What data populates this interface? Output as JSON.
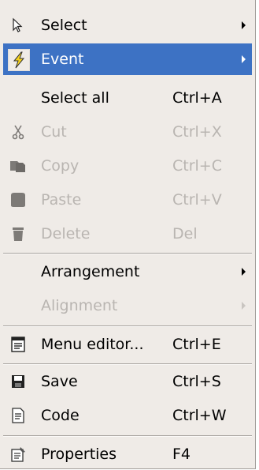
{
  "menu": {
    "items": {
      "select": {
        "label": "Select",
        "icon": "pointer-icon"
      },
      "event": {
        "label": "Event",
        "icon": "lightning-icon"
      },
      "select_all": {
        "label": "Select all",
        "shortcut": "Ctrl+A"
      },
      "cut": {
        "label": "Cut",
        "shortcut": "Ctrl+X",
        "icon": "scissors-icon"
      },
      "copy": {
        "label": "Copy",
        "shortcut": "Ctrl+C",
        "icon": "copy-icon"
      },
      "paste": {
        "label": "Paste",
        "shortcut": "Ctrl+V",
        "icon": "paste-icon"
      },
      "delete": {
        "label": "Delete",
        "shortcut": "Del",
        "icon": "trash-icon"
      },
      "arrangement": {
        "label": "Arrangement"
      },
      "alignment": {
        "label": "Alignment"
      },
      "menu_editor": {
        "label": "Menu editor...",
        "shortcut": "Ctrl+E",
        "icon": "menu-editor-icon"
      },
      "save": {
        "label": "Save",
        "shortcut": "Ctrl+S",
        "icon": "floppy-disk-icon"
      },
      "code": {
        "label": "Code",
        "shortcut": "Ctrl+W",
        "icon": "code-document-icon"
      },
      "properties": {
        "label": "Properties",
        "shortcut": "F4",
        "icon": "properties-icon"
      }
    }
  },
  "colors": {
    "menu_background": "#efebe7",
    "highlight": "#3d72c4",
    "disabled_text": "#b9b5b1"
  }
}
